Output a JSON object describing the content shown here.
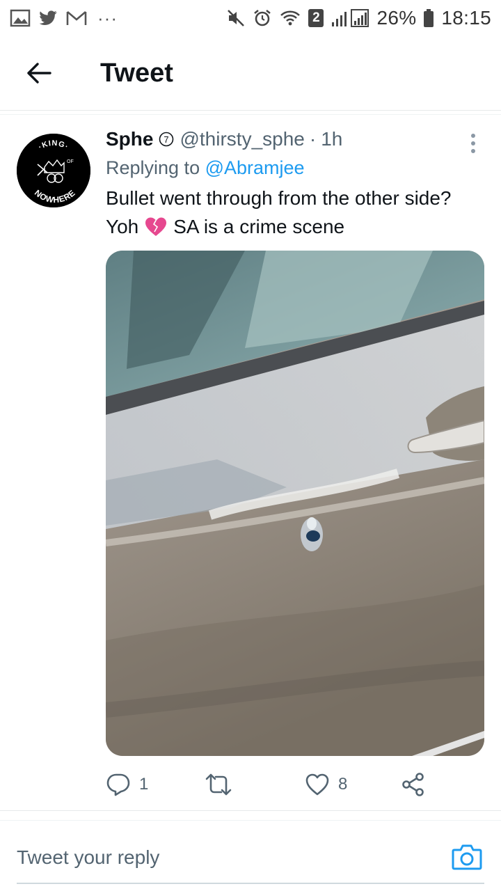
{
  "status_bar": {
    "sim_number": "2",
    "battery": "26%",
    "time": "18:15",
    "more": "···"
  },
  "header": {
    "title": "Tweet"
  },
  "tweet": {
    "author_name": "Sphe",
    "badge_number": "7",
    "handle": "@thirsty_sphe",
    "separator": "·",
    "time": "1h",
    "replying_prefix": "Replying to",
    "replying_to": "@Abramjee",
    "text_line1": "Bullet went through from the other side?",
    "text_line2_start": "Yoh",
    "text_emoji": "broken-heart",
    "text_line2_end": "SA is a crime scene",
    "avatar_text": {
      "top": "·KING·",
      "of": "OF",
      "bottom": "NOWHERE"
    },
    "media_icon": "car-door-photo",
    "stats": {
      "replies": "1",
      "retweets": "",
      "likes": "8"
    }
  },
  "reply_bar": {
    "placeholder": "Tweet your reply",
    "camera_icon": "camera-icon"
  },
  "colors": {
    "accent": "#1d9bf0",
    "secondary_text": "#536471",
    "primary_text": "#0f1419",
    "broken_heart": "#e6488f"
  }
}
